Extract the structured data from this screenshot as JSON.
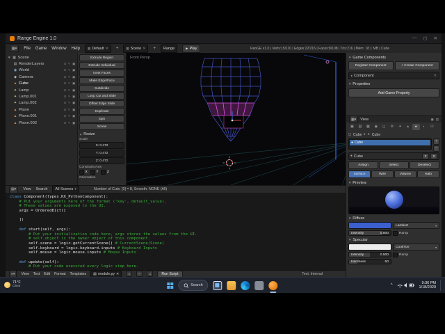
{
  "window": {
    "title": "Range Engine 1.0",
    "minimize": "—",
    "maximize": "▢",
    "close": "✕"
  },
  "info_bar": {
    "menus": [
      "File",
      "Game",
      "Window",
      "Help"
    ],
    "layout_selector": "Default",
    "scene_selector": "Scene",
    "engine_selector": "Range",
    "play_button": "Play",
    "stats": "RanGE v1.0 | Verts:15/110 | Edges:22/216 | Faces:8/108 | Tris:216 | Mem: 18.1 MB | Cube"
  },
  "icons": {
    "renderlayers": "▤",
    "world": "◉",
    "camera": "◆",
    "mesh": "▲",
    "lamp": "✦",
    "eye": "⊙",
    "select": "↖",
    "render": "▣",
    "collapse": "▼",
    "expand": "▸",
    "play": "▶",
    "close": "✕",
    "plus": "+",
    "minus": "−"
  },
  "outliner": {
    "root_label": "Scene",
    "items": [
      {
        "label": "RenderLayers",
        "icon": "renderlayers"
      },
      {
        "label": "World",
        "icon": "world"
      },
      {
        "label": "Camera",
        "icon": "camera"
      },
      {
        "label": "Cube",
        "icon": "mesh",
        "selected": true
      },
      {
        "label": "Lamp",
        "icon": "lamp"
      },
      {
        "label": "Lamp.001",
        "icon": "lamp"
      },
      {
        "label": "Lamp.002",
        "icon": "lamp"
      },
      {
        "label": "Plane",
        "icon": "mesh"
      },
      {
        "label": "Plane.001",
        "icon": "mesh"
      },
      {
        "label": "Plane.002",
        "icon": "mesh"
      }
    ]
  },
  "tool_shelf": {
    "buttons": [
      "Extrude Region",
      "Extrude Individual",
      "Inset Faces",
      "Make Edge/Face",
      "Subdivide",
      "Loop Cut and Slide",
      "Offset Edge Slide",
      "Duplicate",
      "Spin",
      "Screw"
    ],
    "resize": {
      "title": "Resize",
      "scale_label": "Scale",
      "x_value": "X: 0.472",
      "y_value": "Y: 0.472",
      "z_value": "Z: 0.472",
      "constraint_label": "Constraint Axis",
      "axis_x": "X",
      "axis_y": "Y",
      "axis_z": "Z",
      "orientation_label": "Orientation"
    }
  },
  "viewport": {
    "view_label": "Front Persp"
  },
  "operator_bar": {
    "view_menu": "View",
    "search_menu": "Search",
    "scenes_filter": "All Scenes",
    "info": "Number of Cuts: [0] = 8, Smooth: NONE (All)"
  },
  "right_panel": {
    "game_components": {
      "title": "Game Components",
      "register_button": "Register Component",
      "create_button": "+ Create Component",
      "component_label": "Component"
    },
    "properties": {
      "title": "Properties",
      "add_button": "Add Game Property"
    },
    "props_editor": {
      "view_menu": "View",
      "breadcrumb_object": "Cube",
      "breadcrumb_material": "Cube",
      "slot_name": "Cube",
      "material_name": "Cube",
      "fake_user": "F",
      "assign": "Assign",
      "select": "Select",
      "deselect": "Deselect",
      "type_tabs": [
        "Surface",
        "Wire",
        "Volume",
        "Halo"
      ],
      "active_tab": "Surface",
      "preview_title": "Preview",
      "diffuse": {
        "title": "Diffuse",
        "color": "#3c5fd0",
        "shader": "Lambert",
        "intensity_label": "Intensity",
        "intensity_value": "0.800",
        "ramp_label": "Ramp"
      },
      "specular": {
        "title": "Specular",
        "color": "#ececec",
        "shader": "CookTorr",
        "intensity_label": "Intensity",
        "intensity_value": "0.500",
        "ramp_label": "Ramp",
        "hardness_label": "Hardness",
        "hardness_value": "50"
      }
    }
  },
  "text_editor": {
    "lines": [
      "class Component(types.KX_PythonComponent):",
      "    # Put your arguments here of the format ('key', default_value).",
      "    # These values are exposed to the UI.",
      "    args = OrderedDict([",
      "",
      "    ])",
      "",
      "    def start(self, args):",
      "        # Put your initialization code here, args stores the values from the UI.",
      "        # self.object is the owner object of this component.",
      "        self.scene = logic.getCurrentScene() # CurrentScene(Scene)",
      "        self.keyboard = logic.keyboard.inputs # Keyboard Inputs",
      "        self.mouse = logic.mouse.inputs # Mouse Inputs",
      "",
      "    def update(self):",
      "        # Put your code executed every logic step here."
    ],
    "header": {
      "menus": [
        "View",
        "Text",
        "Edit",
        "Format",
        "Templates"
      ],
      "datablock": "module.py",
      "run_button": "Run Script",
      "status": "Text: Internal"
    }
  },
  "taskbar": {
    "weather": {
      "temp": "71°F",
      "condition": "Clear"
    },
    "search_label": "Search",
    "tray": {
      "time": "9:36 PM",
      "date": "1/18/2020"
    }
  }
}
